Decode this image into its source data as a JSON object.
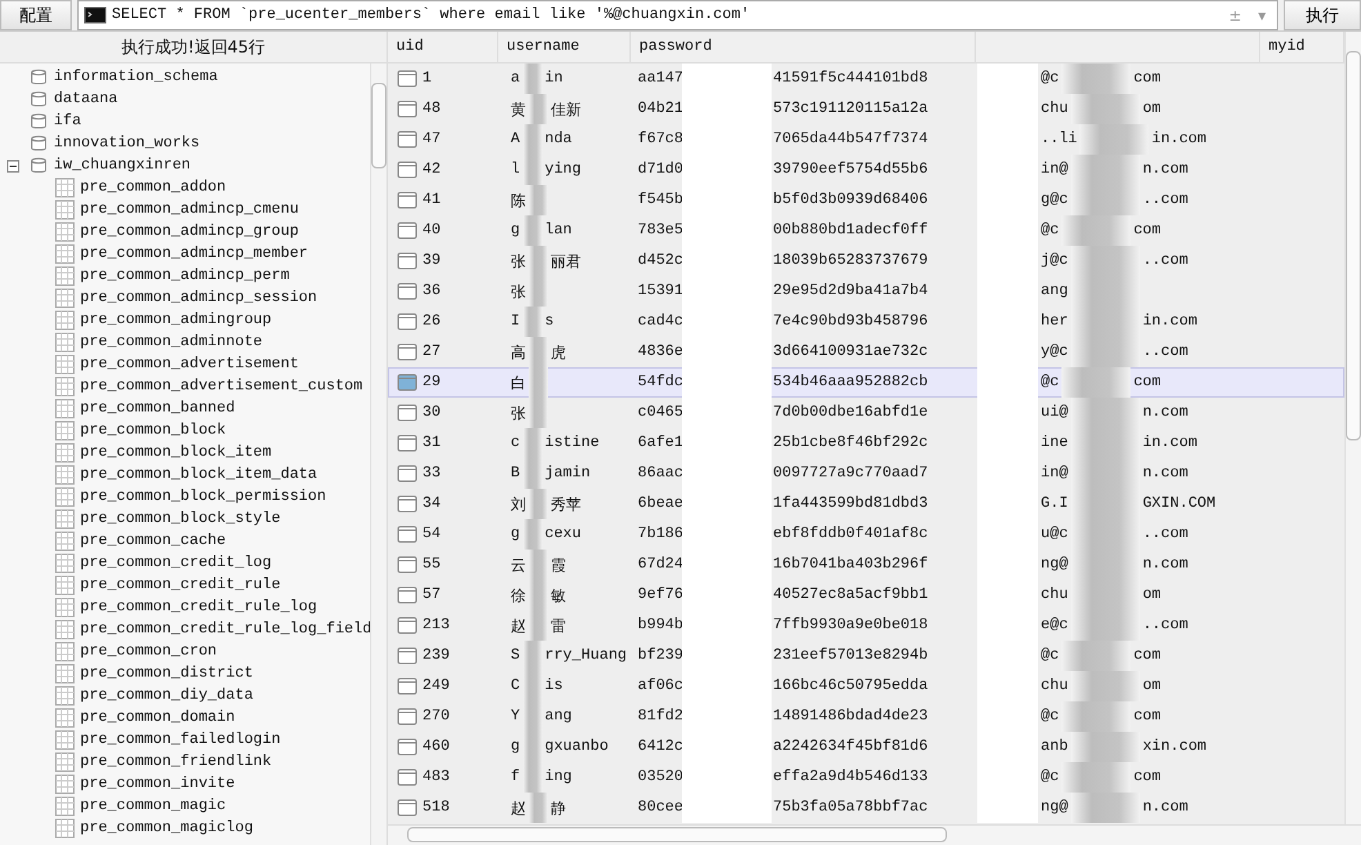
{
  "toolbar": {
    "config_button": "配置",
    "query": "SELECT * FROM `pre_ucenter_members` where email like '%@chuangxin.com'",
    "history_toggle": "±",
    "dropdown": "▾",
    "execute_button": "执行"
  },
  "status": "执行成功!返回45行",
  "tree": [
    {
      "label": "information_schema"
    },
    {
      "label": "dataana"
    },
    {
      "label": "ifa"
    },
    {
      "label": "innovation_works"
    },
    {
      "label": "iw_chuangxinren",
      "expanded": true,
      "children": [
        {
          "label": "pre_common_addon"
        },
        {
          "label": "pre_common_admincp_cmenu"
        },
        {
          "label": "pre_common_admincp_group"
        },
        {
          "label": "pre_common_admincp_member"
        },
        {
          "label": "pre_common_admincp_perm"
        },
        {
          "label": "pre_common_admincp_session"
        },
        {
          "label": "pre_common_admingroup"
        },
        {
          "label": "pre_common_adminnote"
        },
        {
          "label": "pre_common_advertisement"
        },
        {
          "label": "pre_common_advertisement_custom"
        },
        {
          "label": "pre_common_banned"
        },
        {
          "label": "pre_common_block"
        },
        {
          "label": "pre_common_block_item"
        },
        {
          "label": "pre_common_block_item_data"
        },
        {
          "label": "pre_common_block_permission"
        },
        {
          "label": "pre_common_block_style"
        },
        {
          "label": "pre_common_cache"
        },
        {
          "label": "pre_common_credit_log"
        },
        {
          "label": "pre_common_credit_rule"
        },
        {
          "label": "pre_common_credit_rule_log"
        },
        {
          "label": "pre_common_credit_rule_log_field"
        },
        {
          "label": "pre_common_cron"
        },
        {
          "label": "pre_common_district"
        },
        {
          "label": "pre_common_diy_data"
        },
        {
          "label": "pre_common_domain"
        },
        {
          "label": "pre_common_failedlogin"
        },
        {
          "label": "pre_common_friendlink"
        },
        {
          "label": "pre_common_invite"
        },
        {
          "label": "pre_common_magic"
        },
        {
          "label": "pre_common_magiclog"
        }
      ]
    }
  ],
  "grid": {
    "columns": [
      "uid",
      "username",
      "password",
      "myid"
    ],
    "rows": [
      {
        "uid": "1",
        "selected": false,
        "username": [
          "a",
          "in"
        ],
        "password": [
          "aa147",
          "41591f5c444101bd8"
        ],
        "email": [
          "@c",
          "com"
        ]
      },
      {
        "uid": "48",
        "selected": false,
        "username": [
          "黄",
          "佳新"
        ],
        "password": [
          "04b21",
          "573c191120115a12a"
        ],
        "email": [
          "chu",
          "om"
        ]
      },
      {
        "uid": "47",
        "selected": false,
        "username": [
          "A",
          "nda"
        ],
        "password": [
          "f67c8",
          "7065da44b547f7374"
        ],
        "email": [
          "..li",
          "in.com"
        ]
      },
      {
        "uid": "42",
        "selected": false,
        "username": [
          "l",
          "ying"
        ],
        "password": [
          "d71d0",
          "39790eef5754d55b6"
        ],
        "email": [
          "in@",
          "n.com"
        ]
      },
      {
        "uid": "41",
        "selected": false,
        "username": [
          "陈"
        ],
        "password": [
          "f545b",
          "b5f0d3b0939d68406"
        ],
        "email": [
          "g@c",
          "..com"
        ]
      },
      {
        "uid": "40",
        "selected": false,
        "username": [
          "g",
          "lan"
        ],
        "password": [
          "783e5",
          "00b880bd1adecf0ff"
        ],
        "email": [
          "@c",
          "com"
        ]
      },
      {
        "uid": "39",
        "selected": false,
        "username": [
          "张",
          "丽君"
        ],
        "password": [
          "d452c",
          "18039b65283737679"
        ],
        "email": [
          "j@c",
          "..com"
        ]
      },
      {
        "uid": "36",
        "selected": false,
        "username": [
          "张"
        ],
        "password": [
          "15391",
          "29e95d2d9ba41a7b4"
        ],
        "email": [
          "ang"
        ]
      },
      {
        "uid": "26",
        "selected": false,
        "username": [
          "I",
          "s"
        ],
        "password": [
          "cad4c",
          "7e4c90bd93b458796"
        ],
        "email": [
          "her",
          "in.com"
        ]
      },
      {
        "uid": "27",
        "selected": false,
        "username": [
          "高",
          "虎"
        ],
        "password": [
          "4836e",
          "3d664100931ae732c"
        ],
        "email": [
          "y@c",
          "..com"
        ]
      },
      {
        "uid": "29",
        "selected": true,
        "username": [
          "白"
        ],
        "password": [
          "54fdc",
          "534b46aaa952882cb"
        ],
        "email": [
          "@c",
          "com"
        ]
      },
      {
        "uid": "30",
        "selected": false,
        "username": [
          "张"
        ],
        "password": [
          "c0465",
          "7d0b00dbe16abfd1e"
        ],
        "email": [
          "ui@",
          "n.com"
        ]
      },
      {
        "uid": "31",
        "selected": false,
        "username": [
          "c",
          "istine"
        ],
        "password": [
          "6afe1",
          "25b1cbe8f46bf292c"
        ],
        "email": [
          "ine",
          "in.com"
        ]
      },
      {
        "uid": "33",
        "selected": false,
        "username": [
          "B",
          "jamin"
        ],
        "password": [
          "86aac",
          "0097727a9c770aad7"
        ],
        "email": [
          "in@",
          "n.com"
        ]
      },
      {
        "uid": "34",
        "selected": false,
        "username": [
          "刘",
          "秀苹"
        ],
        "password": [
          "6beae",
          "1fa443599bd81dbd3"
        ],
        "email": [
          "G.I",
          "GXIN.COM"
        ]
      },
      {
        "uid": "54",
        "selected": false,
        "username": [
          "g",
          "cexu"
        ],
        "password": [
          "7b186",
          "ebf8fddb0f401af8c"
        ],
        "email": [
          "u@c",
          "..com"
        ]
      },
      {
        "uid": "55",
        "selected": false,
        "username": [
          "云",
          "霞"
        ],
        "password": [
          "67d24",
          "16b7041ba403b296f"
        ],
        "email": [
          "ng@",
          "n.com"
        ]
      },
      {
        "uid": "57",
        "selected": false,
        "username": [
          "徐",
          "敏"
        ],
        "password": [
          "9ef76",
          "40527ec8a5acf9bb1"
        ],
        "email": [
          "chu",
          "om"
        ]
      },
      {
        "uid": "213",
        "selected": false,
        "username": [
          "赵",
          "雷"
        ],
        "password": [
          "b994b",
          "7ffb9930a9e0be018"
        ],
        "email": [
          "e@c",
          "..com"
        ]
      },
      {
        "uid": "239",
        "selected": false,
        "username": [
          "S",
          "rry_Huang"
        ],
        "password": [
          "bf239",
          "231eef57013e8294b"
        ],
        "email": [
          "@c",
          "com"
        ]
      },
      {
        "uid": "249",
        "selected": false,
        "username": [
          "C",
          "is"
        ],
        "password": [
          "af06c",
          "166bc46c50795edda"
        ],
        "email": [
          "chu",
          "om"
        ]
      },
      {
        "uid": "270",
        "selected": false,
        "username": [
          "Y",
          "ang"
        ],
        "password": [
          "81fd2",
          "14891486bdad4de23"
        ],
        "email": [
          "@c",
          "com"
        ]
      },
      {
        "uid": "460",
        "selected": false,
        "username": [
          "g",
          "gxuanbo"
        ],
        "password": [
          "6412c",
          "a2242634f45bf81d6"
        ],
        "email": [
          "anb",
          "xin.com"
        ]
      },
      {
        "uid": "483",
        "selected": false,
        "username": [
          "f",
          "ing"
        ],
        "password": [
          "03520",
          "effa2a9d4b546d133"
        ],
        "email": [
          "@c",
          "com"
        ]
      },
      {
        "uid": "518",
        "selected": false,
        "username": [
          "赵",
          "静"
        ],
        "password": [
          "80cee",
          "75b3fa05a78bbf7ac"
        ],
        "email": [
          "ng@",
          "n.com"
        ]
      }
    ]
  }
}
